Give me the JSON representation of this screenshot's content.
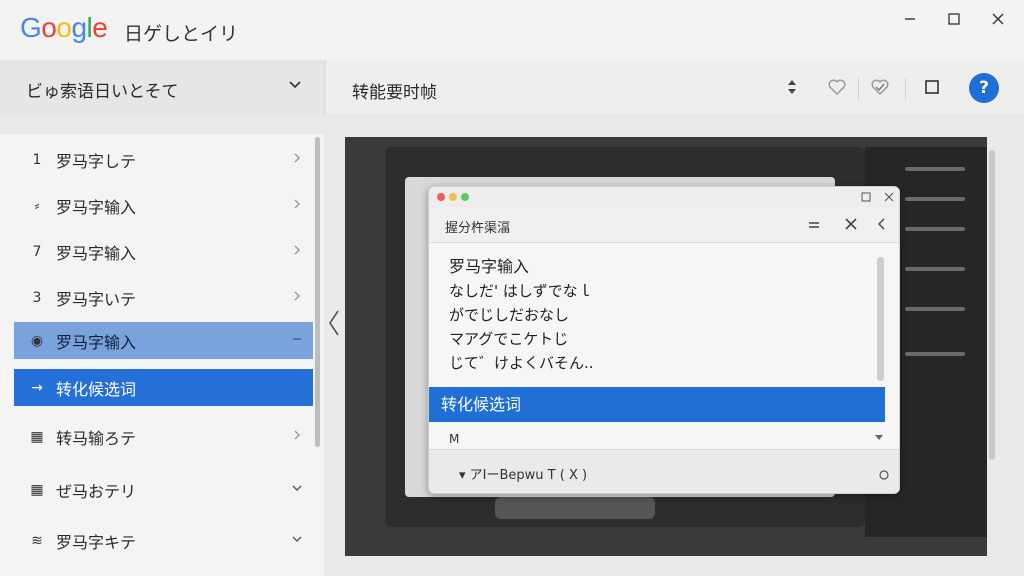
{
  "window": {
    "logo_letters": [
      {
        "ch": "G",
        "color": "#4285F4"
      },
      {
        "ch": "o",
        "color": "#EA4335"
      },
      {
        "ch": "o",
        "color": "#FBBC05"
      },
      {
        "ch": "g",
        "color": "#4285F4"
      },
      {
        "ch": "l",
        "color": "#34A853"
      },
      {
        "ch": "e",
        "color": "#EA4335"
      }
    ],
    "title": "日ゲしとイリ",
    "controls": {
      "minimize": "minimize-icon",
      "maximize": "maximize-icon",
      "close": "close-icon"
    }
  },
  "header": {
    "dropdown_label": "ビゅ索语日いとそて",
    "page_title": "转能要时帧",
    "tools": [
      "sort-icon",
      "heart-icon",
      "check-heart-icon",
      "square-icon"
    ],
    "help_label": "?"
  },
  "sidebar": {
    "items": [
      {
        "icon": "1",
        "label": "罗马字しテ",
        "state": "normal",
        "chevron": "right"
      },
      {
        "icon": "⸗",
        "label": "罗马字输入",
        "state": "normal",
        "chevron": "right"
      },
      {
        "icon": "7",
        "label": "罗马字输入",
        "state": "normal",
        "chevron": "right"
      },
      {
        "icon": "3",
        "label": "罗马字いテ",
        "state": "normal",
        "chevron": "right"
      },
      {
        "icon": "◉",
        "label": "罗马字输入",
        "state": "selected",
        "chevron": "dash"
      },
      {
        "icon": "→",
        "label": "转化候选词",
        "state": "active",
        "chevron": "none"
      },
      {
        "icon": "▦",
        "label": "转马输ろテ",
        "state": "normal",
        "chevron": "right"
      },
      {
        "icon": "▦",
        "label": "ぜ马おテリ",
        "state": "normal",
        "chevron": "down"
      },
      {
        "icon": "≋",
        "label": "罗马字キテ",
        "state": "normal",
        "chevron": "down"
      }
    ]
  },
  "popup": {
    "title": "握分杵渠湢",
    "lines": [
      "罗马字输入",
      "なしだ' はしずでなｌ",
      "がでじしだおなし",
      "マアグでこケトじ",
      "じて゛けよくバそん.."
    ],
    "candidate": "转化候选词",
    "input_value": "M",
    "footer_text": "▾ アIーBepwu T ( X )"
  },
  "colors": {
    "accent": "#1f6fd6",
    "selected_row": "#7aa3de",
    "active_row": "#2570d8"
  }
}
